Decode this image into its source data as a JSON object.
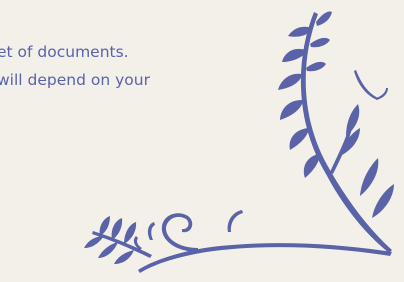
{
  "document": {
    "body_lines": [
      "et of documents.",
      "will depend on your"
    ]
  },
  "decoration": {
    "name": "floral-corner-ornament",
    "color": "#5a62a8",
    "background": "#f2f0e9"
  }
}
